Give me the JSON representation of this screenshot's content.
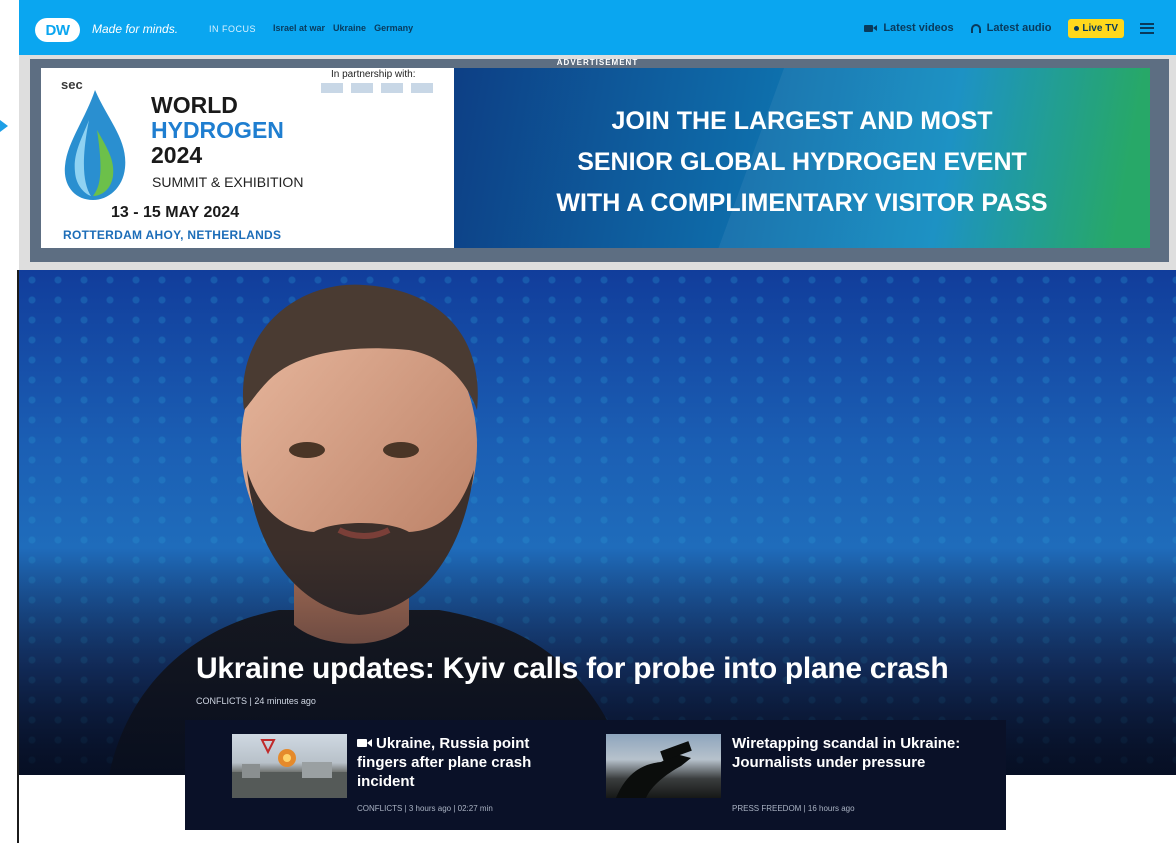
{
  "header": {
    "logo_text": "DW",
    "tagline": "Made for minds.",
    "in_focus_label": "IN FOCUS",
    "focus_links": [
      "Israel at war",
      "Ukraine",
      "Germany"
    ],
    "latest_videos": "Latest videos",
    "latest_audio": "Latest audio",
    "live_tv": "Live TV",
    "brand_color": "#0aa6f0",
    "live_color": "#ffd81c"
  },
  "ad": {
    "label": "ADVERTISEMENT",
    "sponsor": "sec",
    "partnership_text": "In partnership with:",
    "title_line1": "WORLD",
    "title_line2": "HYDROGEN",
    "title_line3": "2024",
    "subtitle": "SUMMIT & EXHIBITION",
    "dates": "13 - 15 MAY 2024",
    "venue": "ROTTERDAM AHOY, NETHERLANDS",
    "headline_lines": [
      "JOIN THE LARGEST AND MOST",
      "SENIOR GLOBAL HYDROGEN EVENT",
      "WITH A COMPLIMENTARY VISITOR PASS"
    ]
  },
  "hero": {
    "title": "Ukraine updates: Kyiv calls for probe into plane crash",
    "meta": "CONFLICTS | 24 minutes ago"
  },
  "teasers": [
    {
      "title": "Ukraine, Russia point fingers after plane crash incident",
      "meta": "CONFLICTS | 3 hours ago | 02:27 min",
      "icon": "video-camera-icon"
    },
    {
      "title": "Wiretapping scandal in Ukraine: Journalists under pressure",
      "meta": "PRESS FREEDOM | 16 hours ago"
    }
  ]
}
